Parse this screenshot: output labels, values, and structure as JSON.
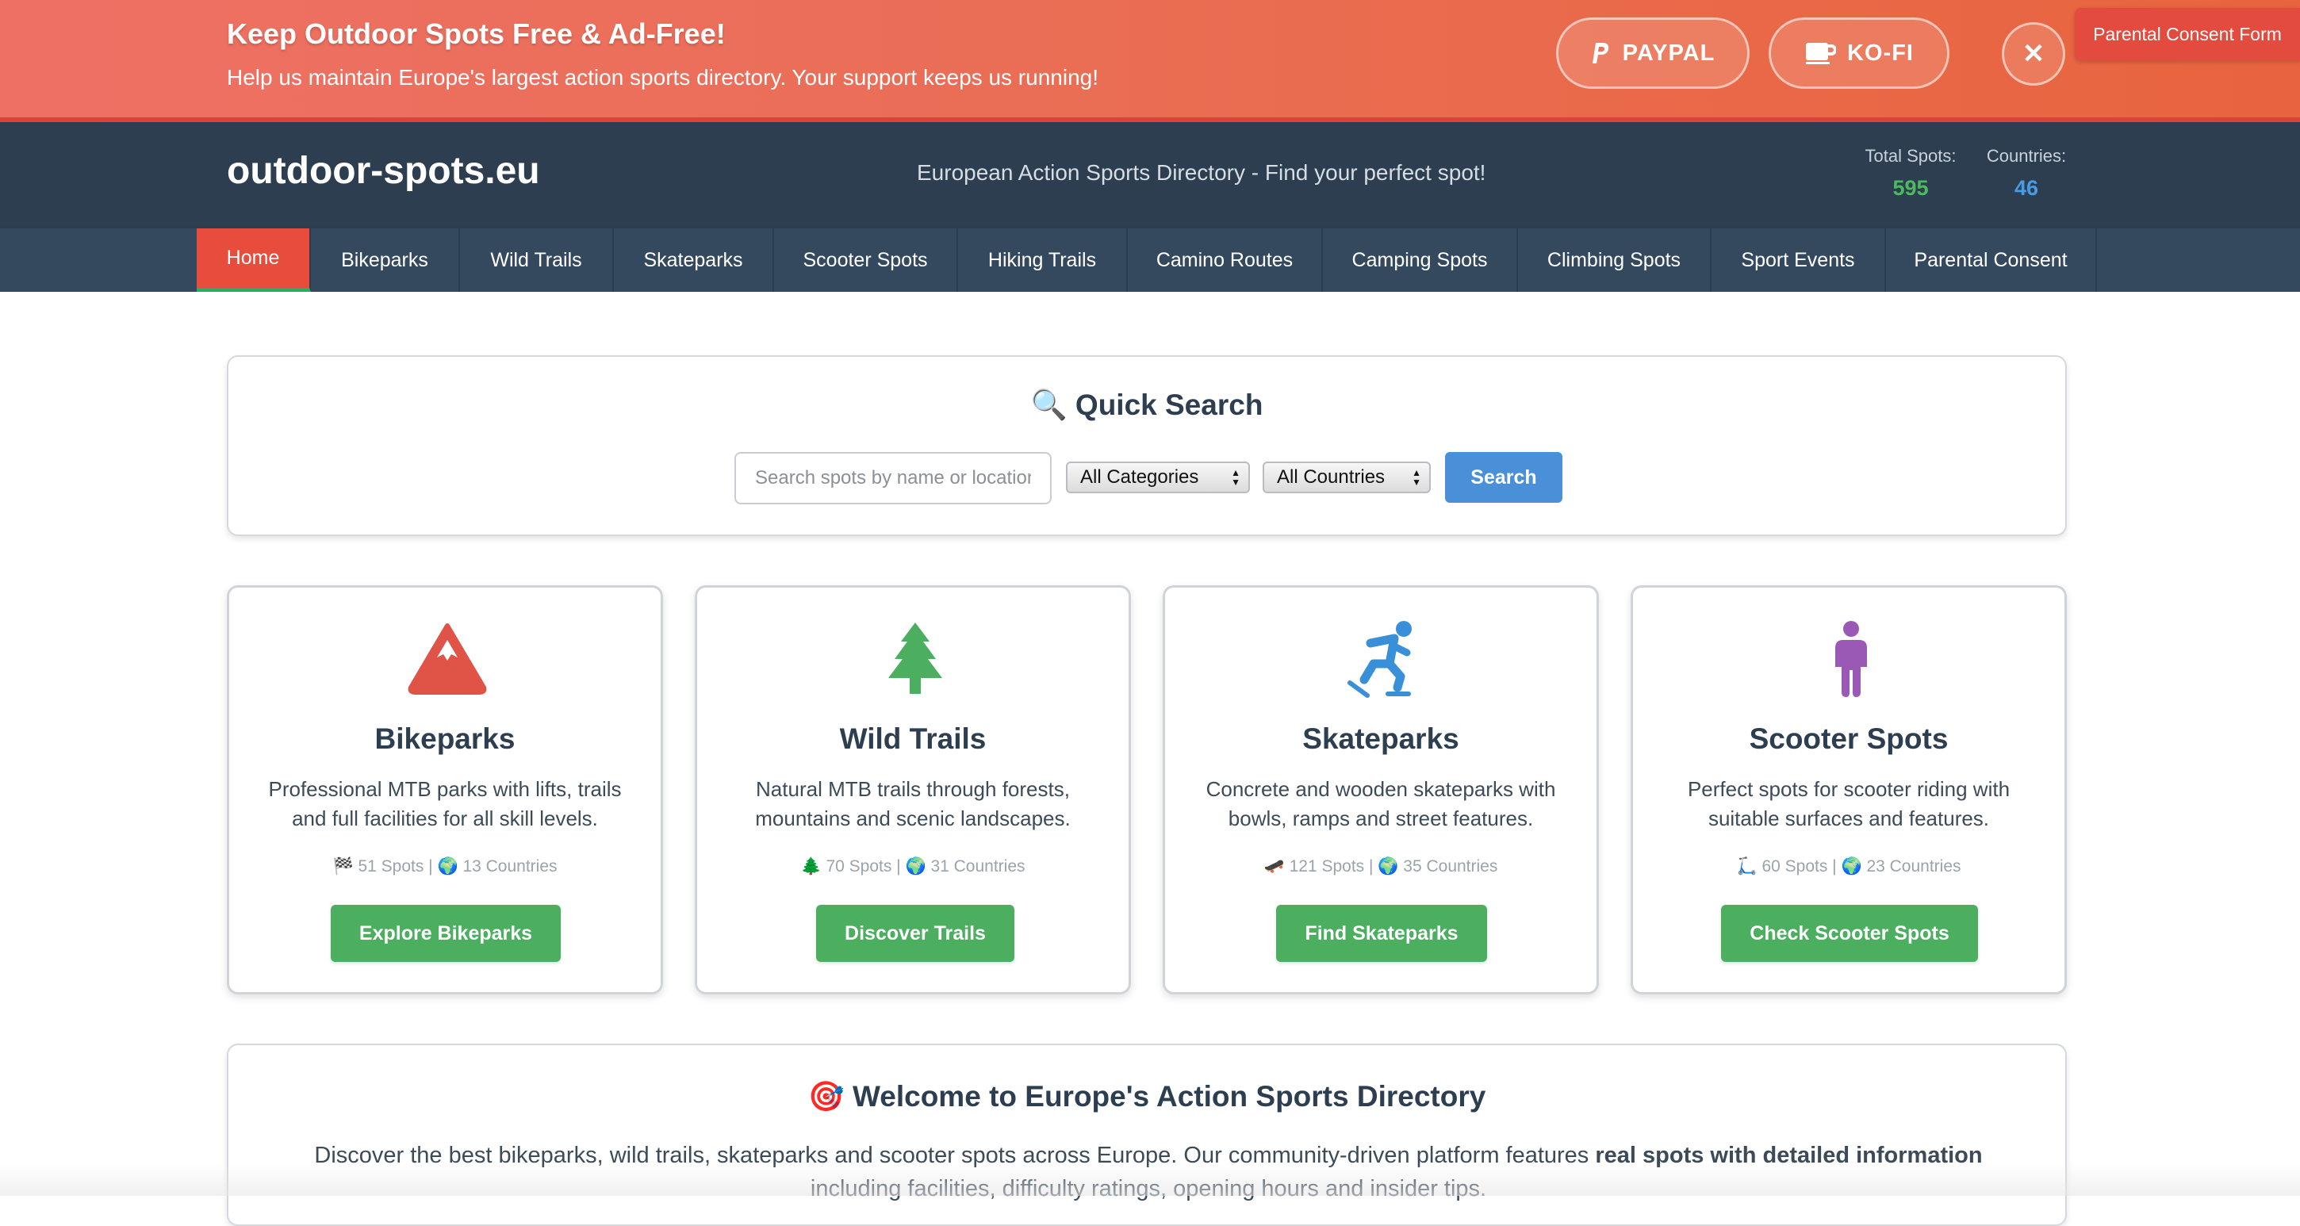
{
  "banner": {
    "title": "Keep Outdoor Spots Free & Ad-Free!",
    "subtitle": "Help us maintain Europe's largest action sports directory. Your support keeps us running!",
    "paypal_label": "PAYPAL",
    "kofi_label": "KO-FI",
    "close_label": "✕",
    "consent_tab_label": "Parental Consent Form"
  },
  "header": {
    "logo": "outdoor-spots.eu",
    "tagline": "European Action Sports Directory - Find your perfect spot!",
    "total_spots_label": "Total Spots:",
    "total_spots_value": "595",
    "countries_label": "Countries:",
    "countries_value": "46"
  },
  "nav": {
    "items": [
      {
        "label": "Home"
      },
      {
        "label": "Bikeparks"
      },
      {
        "label": "Wild Trails"
      },
      {
        "label": "Skateparks"
      },
      {
        "label": "Scooter Spots"
      },
      {
        "label": "Hiking Trails"
      },
      {
        "label": "Camino Routes"
      },
      {
        "label": "Camping Spots"
      },
      {
        "label": "Climbing Spots"
      },
      {
        "label": "Sport Events"
      },
      {
        "label": "Parental Consent"
      }
    ]
  },
  "search": {
    "title": "🔍 Quick Search",
    "placeholder": "Search spots by name or location...",
    "category_selected": "All Categories",
    "country_selected": "All Countries",
    "button_label": "Search"
  },
  "cards": [
    {
      "icon": "mountain-icon",
      "title": "Bikeparks",
      "description": "Professional MTB parks with lifts, trails and full facilities for all skill levels.",
      "meta": "🏁 51 Spots | 🌍 13 Countries",
      "button": "Explore Bikeparks"
    },
    {
      "icon": "tree-icon",
      "title": "Wild Trails",
      "description": "Natural MTB trails through forests, mountains and scenic landscapes.",
      "meta": "🌲 70 Spots | 🌍 31 Countries",
      "button": "Discover Trails"
    },
    {
      "icon": "skater-icon",
      "title": "Skateparks",
      "description": "Concrete and wooden skateparks with bowls, ramps and street features.",
      "meta": "🛹 121 Spots | 🌍 35 Countries",
      "button": "Find Skateparks"
    },
    {
      "icon": "child-icon",
      "title": "Scooter Spots",
      "description": "Perfect spots for scooter riding with suitable surfaces and features.",
      "meta": "🛴 60 Spots | 🌍 23 Countries",
      "button": "Check Scooter Spots"
    }
  ],
  "welcome": {
    "title": "🎯 Welcome to Europe's Action Sports Directory",
    "text_before": "Discover the best bikeparks, wild trails, skateparks and scooter spots across Europe. Our community-driven platform features ",
    "text_bold": "real spots with detailed information",
    "text_after": " including facilities, difficulty ratings, opening hours and insider tips."
  },
  "colors": {
    "banner_start": "#ee7065",
    "banner_end": "#e8643e",
    "header_bg": "#2c3e50",
    "nav_bg": "#34495e",
    "nav_active": "#e74c3c",
    "total_spots_color": "#4cbb5e",
    "countries_color": "#4a9be6",
    "button_green": "#4caf60",
    "search_blue": "#4a90d9",
    "icon_bikeparks": "#e05347",
    "icon_trails": "#4caf60",
    "icon_skate": "#3a8fd9",
    "icon_scooter": "#9b59b6"
  }
}
